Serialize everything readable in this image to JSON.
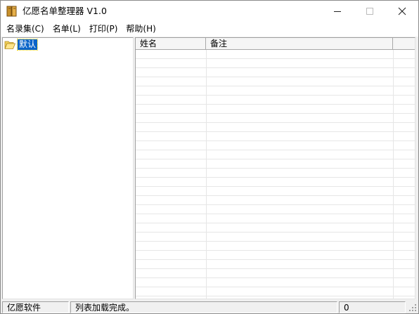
{
  "window": {
    "title": "亿愿名单整理器 V1.0",
    "icon": "book-icon",
    "controls": {
      "minimize": "minimize-icon",
      "maximize": "maximize-icon",
      "close": "close-icon"
    }
  },
  "menu": {
    "items": [
      {
        "label": "名录集(C)"
      },
      {
        "label": "名单(L)"
      },
      {
        "label": "打印(P)"
      },
      {
        "label": "帮助(H)"
      }
    ]
  },
  "tree": {
    "nodes": [
      {
        "label": "默认",
        "icon": "folder-open-icon",
        "selected": true
      }
    ]
  },
  "list": {
    "columns": [
      {
        "label": "姓名"
      },
      {
        "label": "备注"
      },
      {
        "label": ""
      }
    ],
    "rows": []
  },
  "statusbar": {
    "panels": [
      "亿愿软件",
      "列表加载完成。",
      "0"
    ]
  },
  "colors": {
    "selection": "#0a64c8",
    "titlebar": "#ffffff",
    "chrome": "#f0f0f0"
  }
}
